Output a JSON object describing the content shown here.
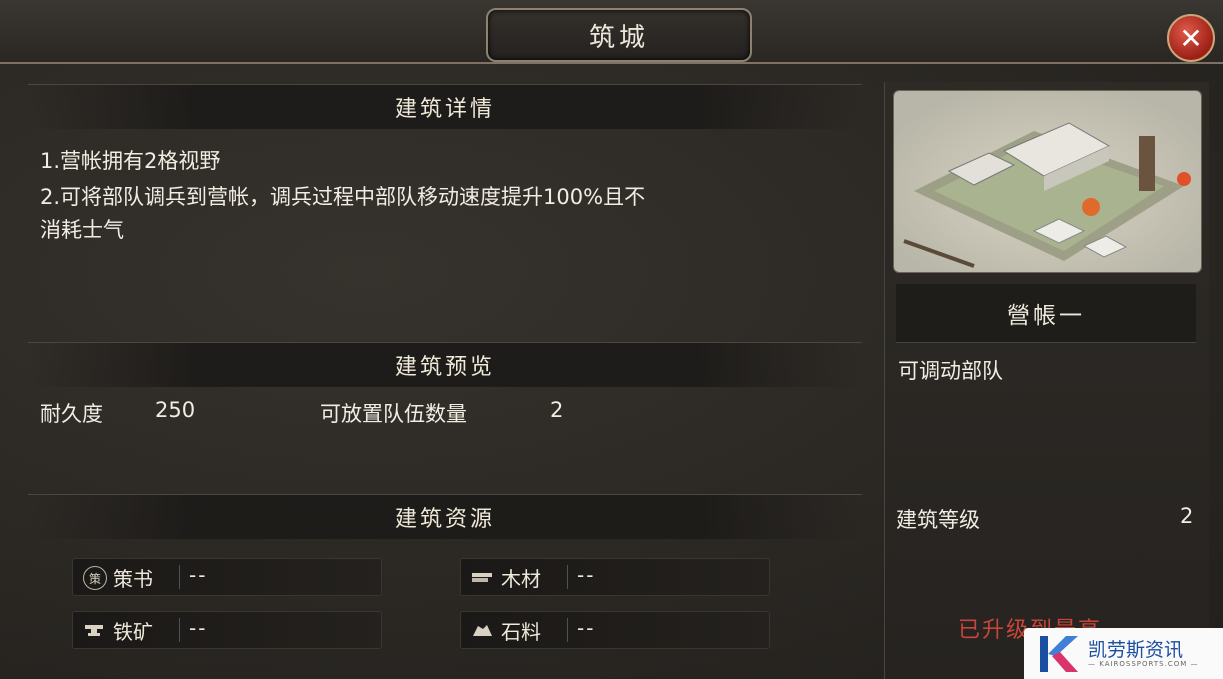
{
  "window": {
    "title": "筑城"
  },
  "sections": {
    "details_title": "建筑详情",
    "preview_title": "建筑预览",
    "resources_title": "建筑资源"
  },
  "description": [
    "1.营帐拥有2格视野",
    "2.可将部队调兵到营帐，调兵过程中部队移动速度提升100%且不",
    "消耗士气"
  ],
  "stats": {
    "durability_label": "耐久度",
    "durability_value": "250",
    "capacity_label": "可放置队伍数量",
    "capacity_value": "2"
  },
  "resources": [
    {
      "icon": "strategy-book-icon",
      "badge": "策",
      "label": "策书",
      "value": "--"
    },
    {
      "icon": "wood-icon",
      "label": "木材",
      "value": "--"
    },
    {
      "icon": "iron-ore-icon",
      "label": "铁矿",
      "value": "--"
    },
    {
      "icon": "stone-icon",
      "label": "石料",
      "value": "--"
    }
  ],
  "building": {
    "name": "營帳一",
    "ability": "可调动部队",
    "level_label": "建筑等级",
    "level_value": "2",
    "status": "已升级到最高"
  },
  "watermark": {
    "text": "凯劳斯资讯",
    "sub": "— KAIROSSPORTS.COM —"
  },
  "colors": {
    "accent_red": "#c8453a",
    "frame_gold": "#8d8170",
    "close_red": "#b3281e"
  }
}
